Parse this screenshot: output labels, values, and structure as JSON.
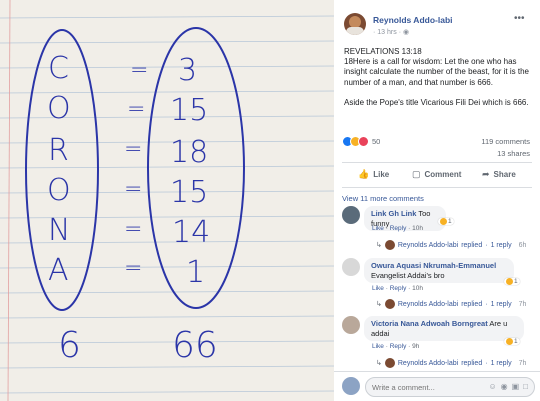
{
  "photo": {
    "left_letters": [
      "C",
      "O",
      "R",
      "O",
      "N",
      "A"
    ],
    "equals": [
      "=",
      "=",
      "=",
      "=",
      "=",
      "="
    ],
    "right_numbers": [
      "3",
      "15",
      "18",
      "15",
      "14",
      "1"
    ],
    "sum_left": "6",
    "sum_right": "66"
  },
  "post": {
    "author": "Reynolds Addo-labi",
    "time": "13 hrs",
    "more_icon": "more-horizontal-icon",
    "paragraph1": "REVELATIONS 13:18",
    "paragraph2": "18Here is a call for wisdom: Let the one who has insight calculate the number of the beast, for it is the number of a man, and that number is 666.",
    "paragraph3": "Aside the Pope's title Vicarious Fili Dei which is 666.",
    "reaction_count": "50",
    "comment_count": "119 comments",
    "share_count": "13 shares"
  },
  "actions": {
    "like": "Like",
    "comment": "Comment",
    "share": "Share"
  },
  "view_more": "View 11 more comments",
  "comments": [
    {
      "name": "Link Gh Link",
      "text": "Too funny",
      "like": "Like",
      "reply": "Reply",
      "time": "10h",
      "reaction": "1",
      "reply_author": "Reynolds Addo-labi",
      "reply_text": "replied",
      "reply_count": "1 reply",
      "reply_time": "6h"
    },
    {
      "name": "Owura Aquasi Nkrumah-Emmanuel",
      "text": "Evangelist Addai's bro",
      "like": "Like",
      "reply": "Reply",
      "time": "10h",
      "reaction": "1",
      "reply_author": "Reynolds Addo-labi",
      "reply_text": "replied",
      "reply_count": "1 reply",
      "reply_time": "7h"
    },
    {
      "name": "Victoria Nana Adwoah Borngreat",
      "text_line1": "Are u",
      "text_line2": "addai",
      "like": "Like",
      "reply": "Reply",
      "time": "9h",
      "reaction": "1",
      "reply_author": "Reynolds Addo-labi",
      "reply_text": "replied",
      "reply_count": "1 reply",
      "reply_time": "7h"
    }
  ],
  "write_comment": {
    "placeholder": "Write a comment..."
  },
  "colors": {
    "link_blue": "#385898",
    "ink_blue": "#2b35a8",
    "fb_blue": "#1877f2"
  }
}
